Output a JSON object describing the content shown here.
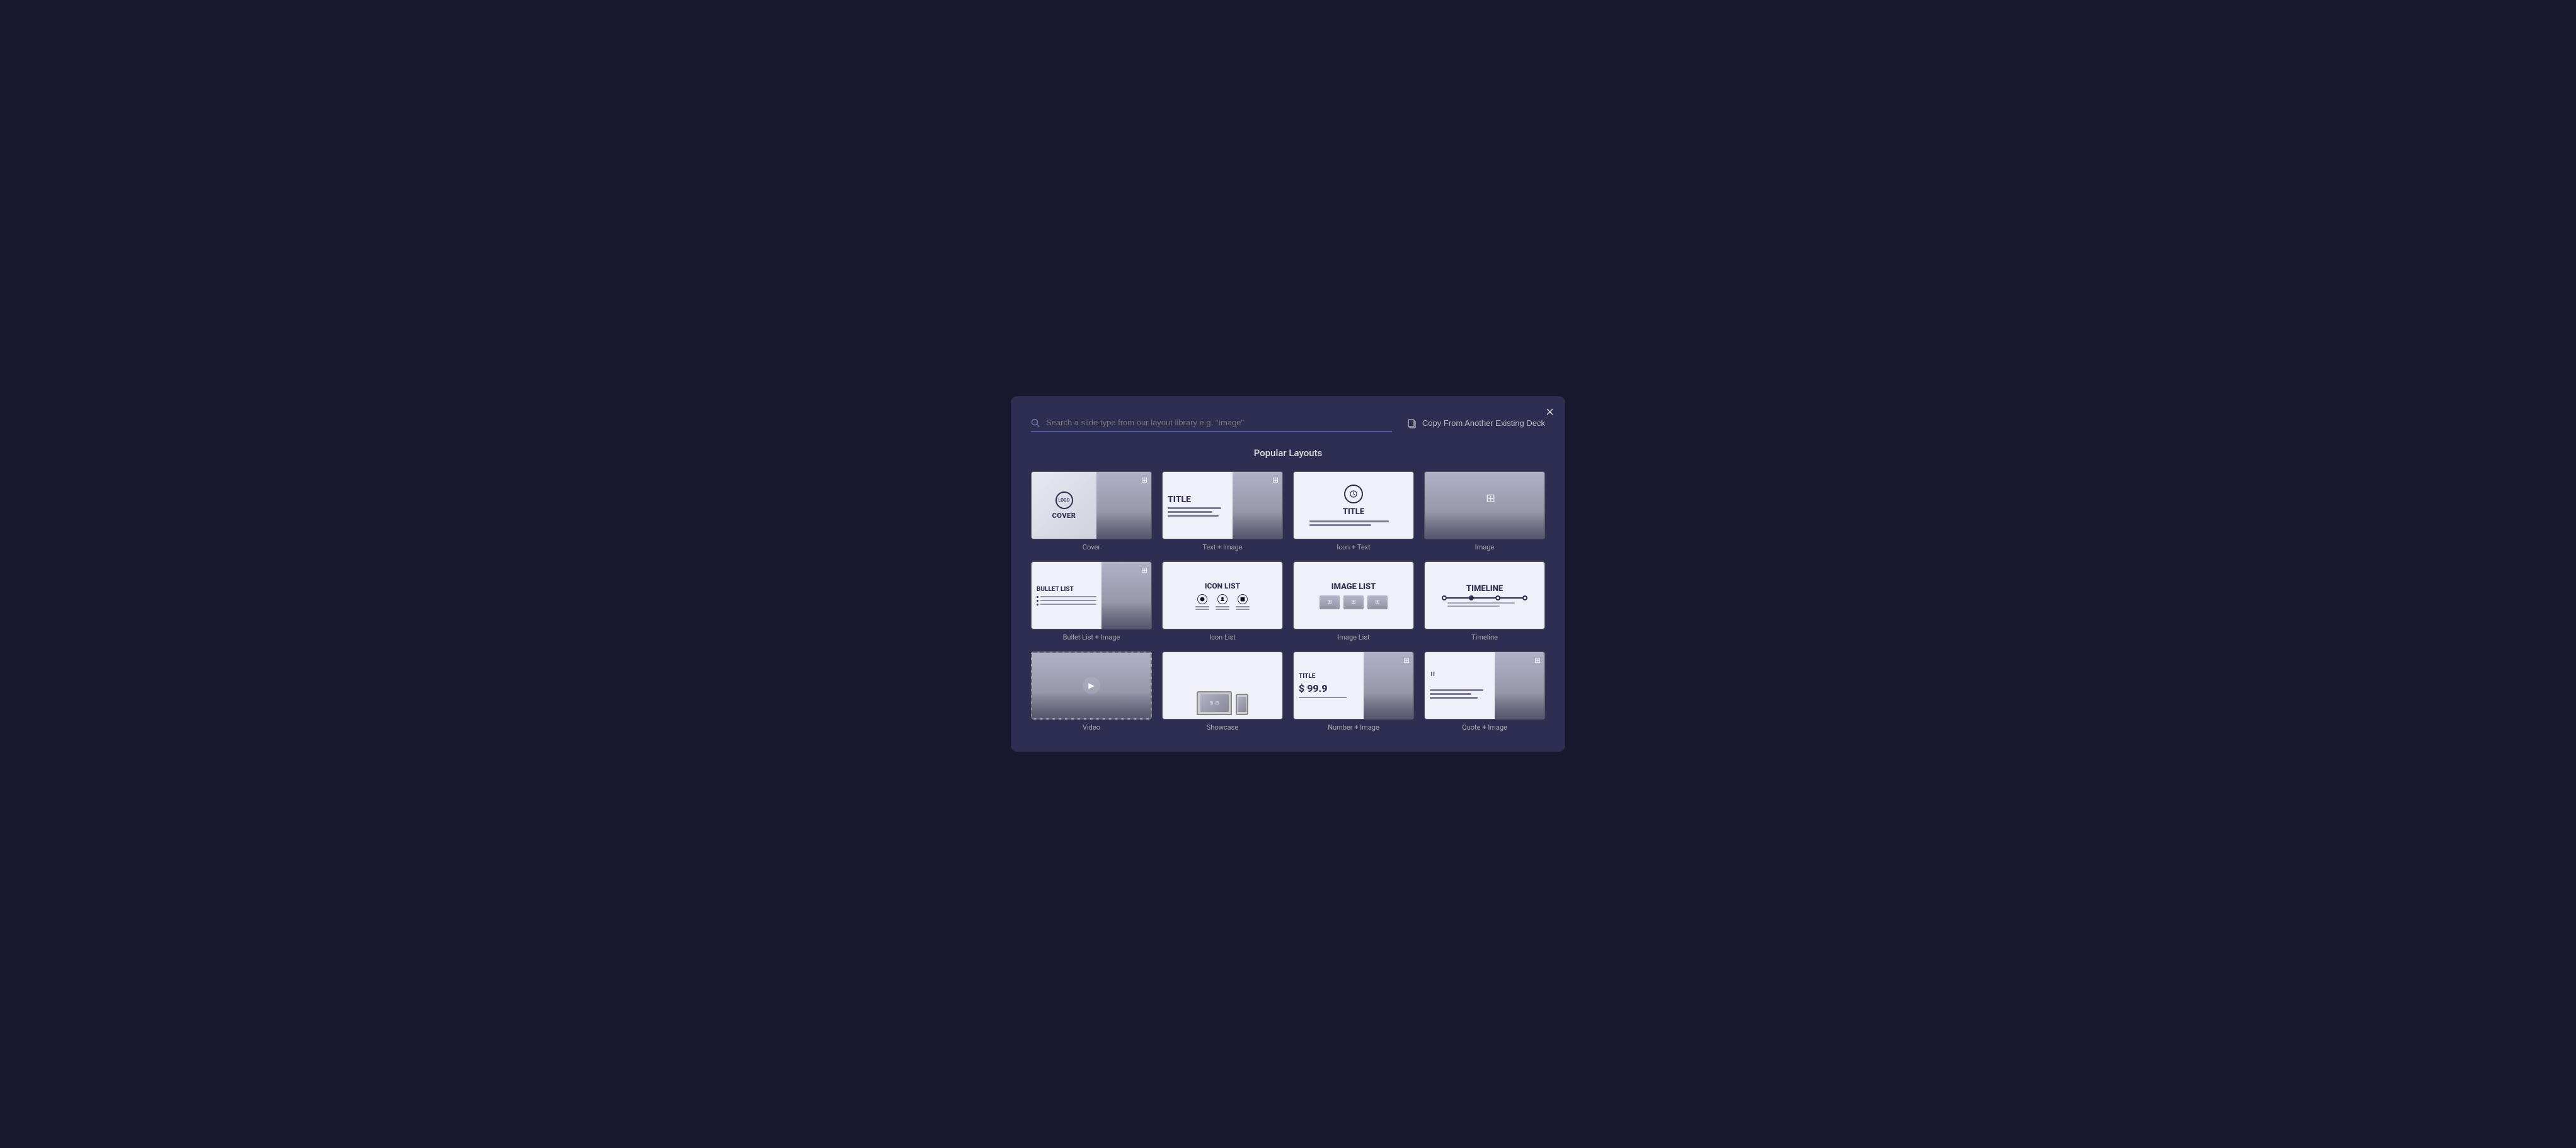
{
  "modal": {
    "title": "Popular Layouts",
    "close_label": "×",
    "search_placeholder": "Search a slide type from our layout library e.g. \"Image\"",
    "copy_button_label": "Copy From Another Existing Deck"
  },
  "layouts": [
    {
      "id": "cover",
      "label": "Cover",
      "type": "cover"
    },
    {
      "id": "text-image",
      "label": "Text + Image",
      "type": "text-image"
    },
    {
      "id": "icon-text",
      "label": "Icon + Text",
      "type": "icon-text"
    },
    {
      "id": "image",
      "label": "Image",
      "type": "image"
    },
    {
      "id": "bullet-list-image",
      "label": "Bullet List + Image",
      "type": "bullet-list-image"
    },
    {
      "id": "icon-list",
      "label": "Icon List",
      "type": "icon-list"
    },
    {
      "id": "image-list",
      "label": "Image List",
      "type": "image-list"
    },
    {
      "id": "timeline",
      "label": "Timeline",
      "type": "timeline"
    },
    {
      "id": "video",
      "label": "Video",
      "type": "video"
    },
    {
      "id": "showcase",
      "label": "Showcase",
      "type": "showcase"
    },
    {
      "id": "number-image",
      "label": "Number + Image",
      "type": "number-image"
    },
    {
      "id": "quote-image",
      "label": "Quote + Image",
      "type": "quote-image"
    }
  ],
  "thumb_labels": {
    "cover_logo": "LOGO",
    "cover_cover": "COVER",
    "title_text": "TITLE",
    "title_icon": "TITLE",
    "title_icon_sub": "TITLE",
    "bullet_list": "BULLET LIST",
    "icon_list": "ICON LIST",
    "image_list": "IMAGE LIST",
    "timeline": "TIMELINE",
    "number_title": "TITLE",
    "number_value": "$ 99.9"
  }
}
